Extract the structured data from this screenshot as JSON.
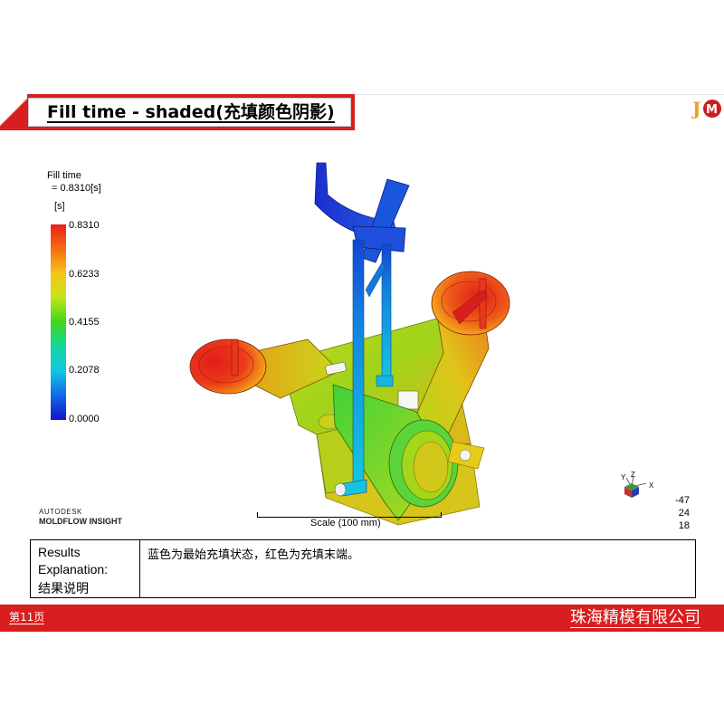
{
  "header": {
    "title": "Fill time - shaded(充填颜色阴影)"
  },
  "logo": {
    "text": "JM",
    "colors": {
      "j": "#f0a020",
      "m": "#cc1e1e"
    }
  },
  "legend": {
    "result_name": "Fill time",
    "result_value": "= 0.8310[s]",
    "unit": "[s]",
    "ticks": [
      "0.8310",
      "0.6233",
      "0.4155",
      "0.2078",
      "0.0000"
    ],
    "gradient_colors": [
      "#e8201d",
      "#f7c317",
      "#41d61b",
      "#10c7e6",
      "#1613c9"
    ]
  },
  "branding": {
    "company": "AUTODESK",
    "product": "MOLDFLOW INSIGHT"
  },
  "scale": {
    "label": "Scale (100 mm)"
  },
  "triad": {
    "axes": [
      "Y",
      "Z",
      "X"
    ],
    "values": [
      "-47",
      "24",
      "18"
    ]
  },
  "results": {
    "label_line1": "Results",
    "label_line2": "Explanation:",
    "label_line3": "结果说明",
    "text": "蓝色为最始充填状态，红色为充填末端。"
  },
  "footer": {
    "page_number": "第11页",
    "company": "珠海精模有限公司"
  },
  "colors": {
    "accent_red": "#d81e1e",
    "fill_start": "#1613c9",
    "fill_end": "#e8201d"
  }
}
